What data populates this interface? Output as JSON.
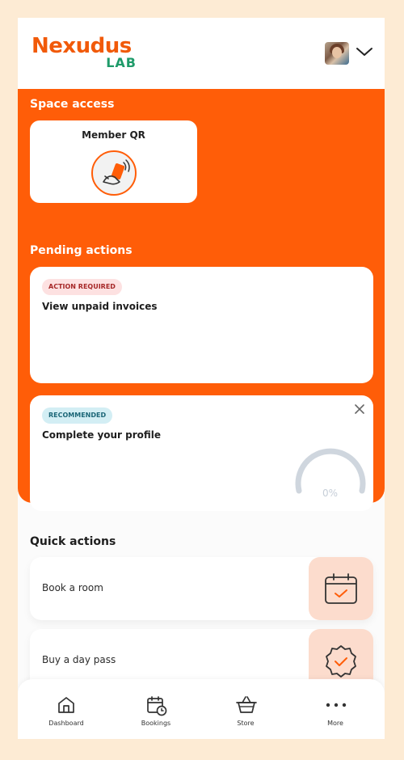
{
  "header": {
    "logo_main": "Nexudus",
    "logo_sub": "LAB"
  },
  "space_access": {
    "title": "Space access",
    "card_label": "Member QR"
  },
  "pending": {
    "title": "Pending actions",
    "cards": [
      {
        "badge": "ACTION REQUIRED",
        "text": "View unpaid invoices"
      },
      {
        "badge": "RECOMMENDED",
        "text": "Complete your profile",
        "progress": "0%"
      }
    ]
  },
  "quick_actions": {
    "title": "Quick actions",
    "items": [
      {
        "label": "Book a room",
        "icon": "calendar-check-icon"
      },
      {
        "label": "Buy a day pass",
        "icon": "badge-check-icon"
      }
    ]
  },
  "nav": {
    "items": [
      {
        "label": "Dashboard",
        "icon": "home-icon"
      },
      {
        "label": "Bookings",
        "icon": "calendar-clock-icon"
      },
      {
        "label": "Store",
        "icon": "basket-icon"
      },
      {
        "label": "More",
        "icon": "more-dots-icon"
      }
    ]
  },
  "colors": {
    "brand": "#ff5d08",
    "brand_green": "#1f9b6a",
    "page_bg": "#fdebd4",
    "accent_soft": "#fcdccd"
  }
}
